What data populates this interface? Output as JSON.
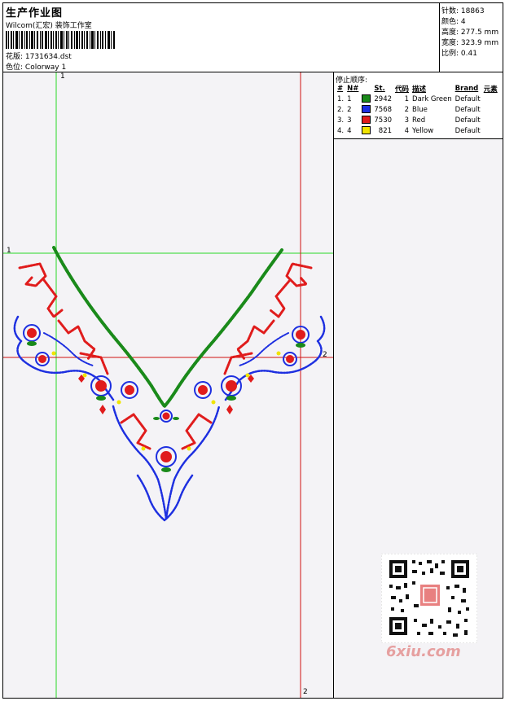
{
  "header": {
    "title": "生产作业图",
    "subtitle": "Wilcom(汇宏) 装饰工作室",
    "design_label": "花版:",
    "design_value": "1731634.dst",
    "colorway_label": "色位:",
    "colorway_value": "Colorway 1"
  },
  "stats": [
    {
      "label": "针数:",
      "value": "18863"
    },
    {
      "label": "颜色:",
      "value": "4"
    },
    {
      "label": "高度:",
      "value": "277.5 mm"
    },
    {
      "label": "宽度:",
      "value": "323.9 mm"
    },
    {
      "label": "比例:",
      "value": "0.41"
    }
  ],
  "stop_sequence": {
    "label": "停止顺序:",
    "headers": [
      "#",
      "N#",
      "St.",
      "代码",
      "描述",
      "Brand",
      "元素"
    ],
    "rows": [
      {
        "idx": "1.",
        "n": "1",
        "color": "#1a8a1a",
        "st": "2942",
        "code": "1",
        "desc": "Dark Green",
        "brand": "Default"
      },
      {
        "idx": "2.",
        "n": "2",
        "color": "#1d2fe0",
        "st": "7568",
        "code": "2",
        "desc": "Blue",
        "brand": "Default"
      },
      {
        "idx": "3.",
        "n": "3",
        "color": "#e01c1c",
        "st": "7530",
        "code": "3",
        "desc": "Red",
        "brand": "Default"
      },
      {
        "idx": "4.",
        "n": "4",
        "color": "#f0e400",
        "st": "821",
        "code": "4",
        "desc": "Yellow",
        "brand": "Default"
      }
    ]
  },
  "guides": {
    "top_marker": "1",
    "left_marker": "1",
    "right_marker": "2",
    "bottom_marker": "2"
  },
  "watermark": "6xiu.com",
  "colors": {
    "green": "#1a8a1a",
    "blue": "#1d2fe0",
    "red": "#e01c1c",
    "yellow": "#f0e400",
    "guide_green": "#27d827",
    "guide_red": "#d01010"
  }
}
